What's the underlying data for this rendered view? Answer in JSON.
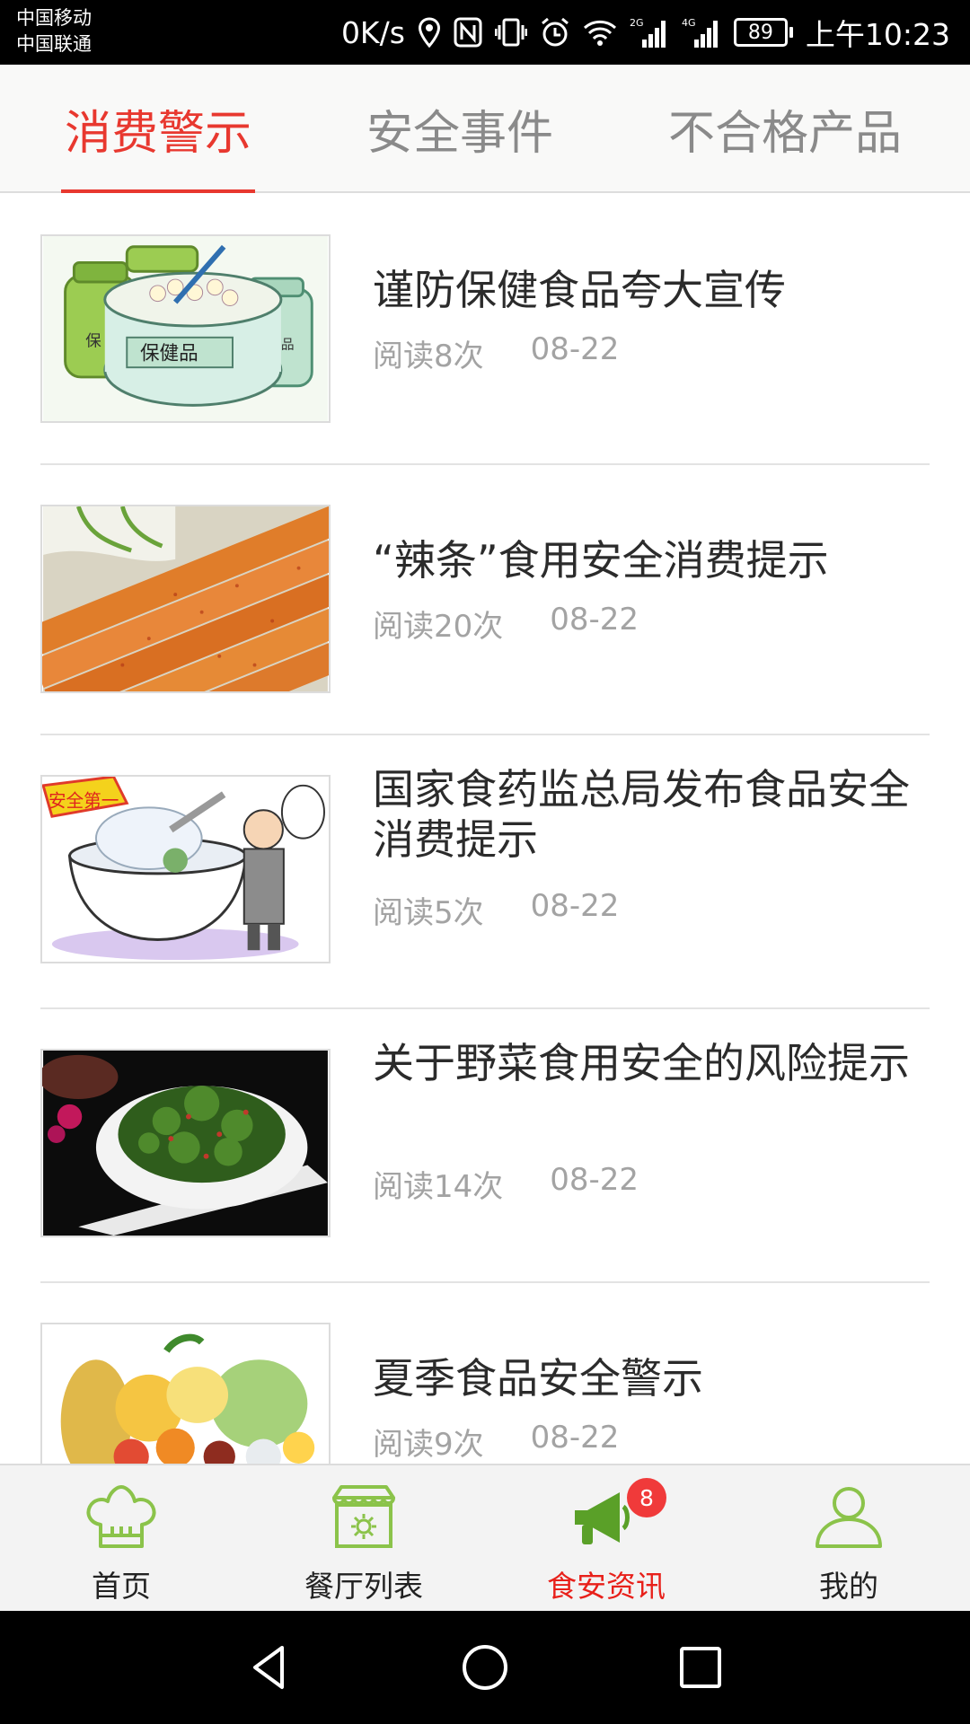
{
  "status_bar": {
    "carrier_1": "中国移动",
    "carrier_2": "中国联通",
    "net_speed": "0K/s",
    "signal_1_label": "2G",
    "signal_2_label": "4G",
    "battery": "89",
    "time": "上午10:23",
    "icons": [
      "location-icon",
      "nfc-icon",
      "vibrate-icon",
      "alarm-icon",
      "wifi-icon",
      "signal-icon",
      "battery-icon"
    ]
  },
  "tabs": [
    {
      "label": "消费警示",
      "active": true
    },
    {
      "label": "安全事件",
      "active": false
    },
    {
      "label": "不合格产品",
      "active": false
    }
  ],
  "articles": [
    {
      "title": "谨防保健食品夸大宣传",
      "reads": "阅读8次",
      "date": "08-22",
      "image": "health-supplement-jars-image"
    },
    {
      "title": "“辣条”食用安全消费提示",
      "reads": "阅读20次",
      "date": "08-22",
      "image": "spicy-strips-image"
    },
    {
      "title": "国家食药监总局发布食品安全消费提示",
      "reads": "阅读5次",
      "date": "08-22",
      "image": "food-safety-cartoon-image"
    },
    {
      "title": "关于野菜食用安全的风险提示",
      "reads": "阅读14次",
      "date": "08-22",
      "image": "wild-vegetable-dish-image"
    },
    {
      "title": "夏季食品安全警示",
      "reads": "阅读9次",
      "date": "08-22",
      "image": "fruits-vegetables-image"
    }
  ],
  "thumb_text": {
    "jar_label": "保健品",
    "jar_side_left": "保",
    "jar_side_right": "保健品",
    "cartoon_banner": "安全第一"
  },
  "bottom_nav": [
    {
      "label": "首页",
      "icon": "chef-hat-icon",
      "active": false
    },
    {
      "label": "餐厅列表",
      "icon": "restaurant-icon",
      "active": false
    },
    {
      "label": "食安资讯",
      "icon": "megaphone-icon",
      "active": true,
      "badge": "8"
    },
    {
      "label": "我的",
      "icon": "user-icon",
      "active": false
    }
  ],
  "colors": {
    "accent": "#e8382f",
    "nav_icon_green": "#8bc34a",
    "megaphone_green": "#5aa028",
    "badge": "#f03a3a"
  }
}
